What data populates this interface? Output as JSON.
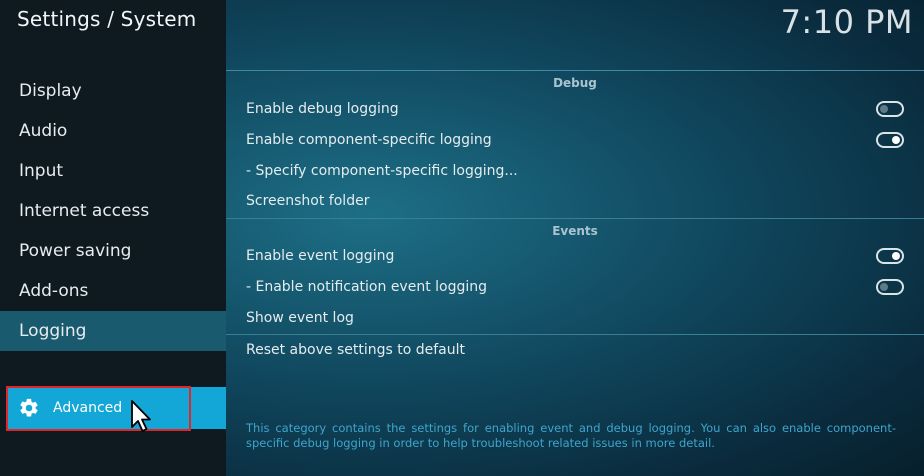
{
  "header": {
    "title": "Settings / System",
    "clock": "7:10 PM"
  },
  "sidebar": {
    "items": [
      {
        "label": "Display"
      },
      {
        "label": "Audio"
      },
      {
        "label": "Input"
      },
      {
        "label": "Internet access"
      },
      {
        "label": "Power saving"
      },
      {
        "label": "Add-ons"
      },
      {
        "label": "Logging",
        "active": true
      }
    ],
    "level_button": {
      "label": "Advanced",
      "icon": "gear-icon"
    }
  },
  "sections": {
    "debug": {
      "title": "Debug",
      "rows": [
        {
          "label": "Enable debug logging",
          "toggle": "off"
        },
        {
          "label": "Enable component-specific logging",
          "toggle": "on"
        },
        {
          "label": "- Specify component-specific logging..."
        },
        {
          "label": "Screenshot folder"
        }
      ]
    },
    "events": {
      "title": "Events",
      "rows": [
        {
          "label": "Enable event logging",
          "toggle": "on"
        },
        {
          "label": "- Enable notification event logging",
          "toggle": "off"
        },
        {
          "label": "Show event log"
        }
      ]
    },
    "reset": {
      "label": "Reset above settings to default"
    }
  },
  "description": "This category contains the settings for enabling event and debug logging. You can also enable component-specific debug logging in order to help troubleshoot related issues in more detail.",
  "colors": {
    "accent": "#12a7d6",
    "active_item": "#195a6e",
    "highlight_border": "#e0262a"
  }
}
